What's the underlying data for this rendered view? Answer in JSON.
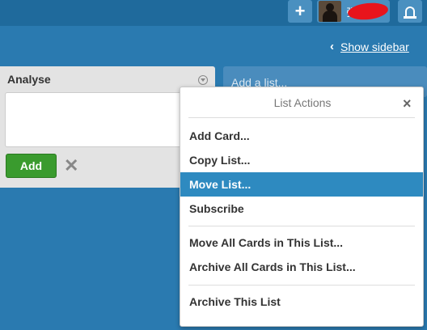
{
  "header": {
    "add_label": "+",
    "user_name": "张",
    "icons": {
      "add": "plus-icon",
      "notifications": "bell-icon"
    }
  },
  "board": {
    "show_sidebar": "Show sidebar"
  },
  "list": {
    "title": "Analyse",
    "add_button": "Add",
    "cancel_label": "✕"
  },
  "add_list": {
    "placeholder": "Add a list..."
  },
  "list_actions": {
    "title": "List Actions",
    "close_label": "×",
    "items": [
      {
        "label": "Add Card..."
      },
      {
        "label": "Copy List..."
      },
      {
        "label": "Move List...",
        "highlighted": true
      },
      {
        "label": "Subscribe"
      },
      {
        "label": "Move All Cards in This List..."
      },
      {
        "label": "Archive All Cards in This List..."
      },
      {
        "label": "Archive This List"
      }
    ]
  },
  "colors": {
    "board_bg": "#2a7ab0",
    "header_bg": "#1f6a9c",
    "add_green": "#3a9b2e",
    "highlight": "#2e8ac0"
  }
}
